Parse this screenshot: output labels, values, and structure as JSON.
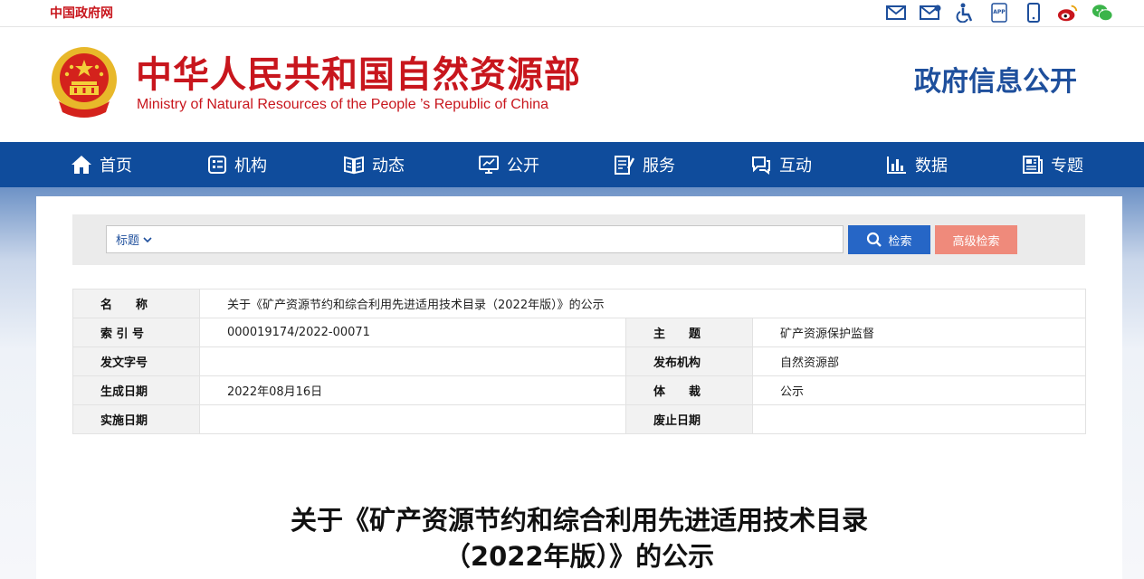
{
  "topbar": {
    "gov_link": "中国政府网",
    "icons": [
      "mail-icon",
      "email-letter-icon",
      "accessibility-icon",
      "app-icon",
      "mobile-icon",
      "weibo-icon",
      "wechat-icon"
    ],
    "app_label": "APP"
  },
  "header": {
    "site_name_cn": "中华人民共和国自然资源部",
    "site_name_en": "Ministry of Natural Resources of the People ’s Republic of China",
    "section_title": "政府信息公开"
  },
  "nav": {
    "items": [
      {
        "label": "首页",
        "icon": "home-icon"
      },
      {
        "label": "机构",
        "icon": "organization-icon"
      },
      {
        "label": "动态",
        "icon": "book-icon"
      },
      {
        "label": "公开",
        "icon": "monitor-icon"
      },
      {
        "label": "服务",
        "icon": "document-edit-icon"
      },
      {
        "label": "互动",
        "icon": "chat-icon"
      },
      {
        "label": "数据",
        "icon": "bar-chart-icon"
      },
      {
        "label": "专题",
        "icon": "newspaper-icon"
      }
    ]
  },
  "search": {
    "field_select": "标题",
    "query": "",
    "search_button": "检索",
    "advanced_button": "高级检索"
  },
  "info": {
    "name_label": "名　　称",
    "name_value": "关于《矿产资源节约和综合利用先进适用技术目录（2022年版）》的公示",
    "index_label": "索 引 号",
    "index_value": "000019174/2022-00071",
    "topic_label": "主　　题",
    "topic_value": "矿产资源保护监督",
    "doc_no_label": "发文字号",
    "doc_no_value": "",
    "issuer_label": "发布机构",
    "issuer_value": "自然资源部",
    "date_label": "生成日期",
    "date_value": "2022年08月16日",
    "genre_label": "体　　裁",
    "genre_value": "公示",
    "effective_label": "实施日期",
    "effective_value": "",
    "expiry_label": "废止日期",
    "expiry_value": ""
  },
  "article": {
    "title_line1": "关于《矿产资源节约和综合利用先进适用技术目录",
    "title_line2": "（2022年版）》的公示"
  },
  "colors": {
    "brand_red": "#c8161d",
    "nav_blue": "#0f4c9c",
    "title_blue": "#1e4f9c",
    "search_blue": "#2666c6",
    "advanced_pink": "#ef8a7b"
  }
}
